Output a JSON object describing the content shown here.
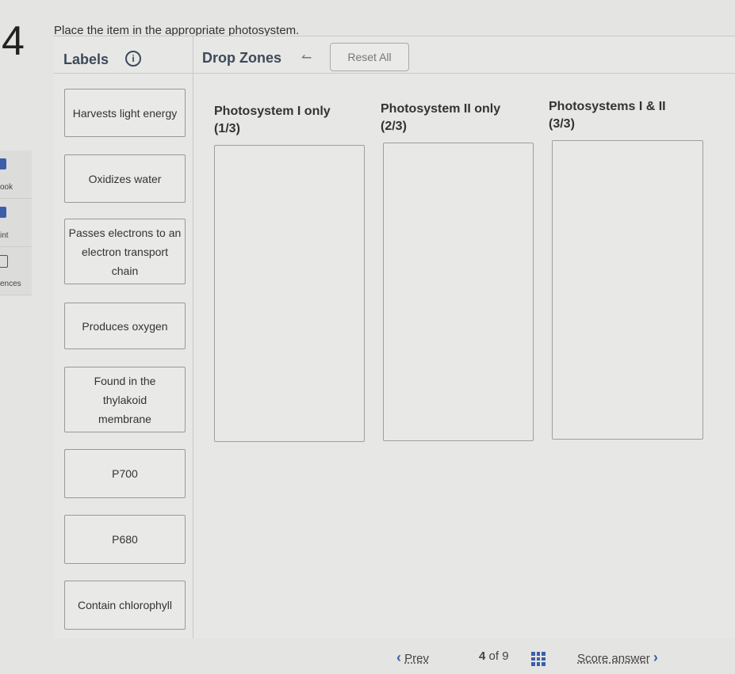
{
  "question_number": "4",
  "sidebar": {
    "items": [
      {
        "label": "ook",
        "icon": "book-icon"
      },
      {
        "label": "int",
        "icon": "print-icon"
      },
      {
        "label": "ences",
        "icon": "folder-icon"
      }
    ]
  },
  "prompt": "Place the item in the appropriate photosystem.",
  "labels_header": "Labels",
  "info_icon": "i",
  "drop_zones_header": "Drop Zones",
  "undo_icon": "↼",
  "reset_label": "Reset All",
  "labels": [
    "Harvests light energy",
    "Oxidizes water",
    "Passes electrons to an electron transport chain",
    "Produces oxygen",
    "Found in the thylakoid membrane",
    "P700",
    "P680",
    "Contain chlorophyll"
  ],
  "zones": [
    {
      "title": "Photosystem I only",
      "count": "(1/3)"
    },
    {
      "title": "Photosystem II only",
      "count": "(2/3)"
    },
    {
      "title": "Photosystems I & II",
      "count": "(3/3)"
    }
  ],
  "footer": {
    "prev": "Prev",
    "page": "4",
    "of": "of",
    "total": "9",
    "score": "Score answer"
  },
  "colors": {
    "accent": "#3b5fa8"
  }
}
